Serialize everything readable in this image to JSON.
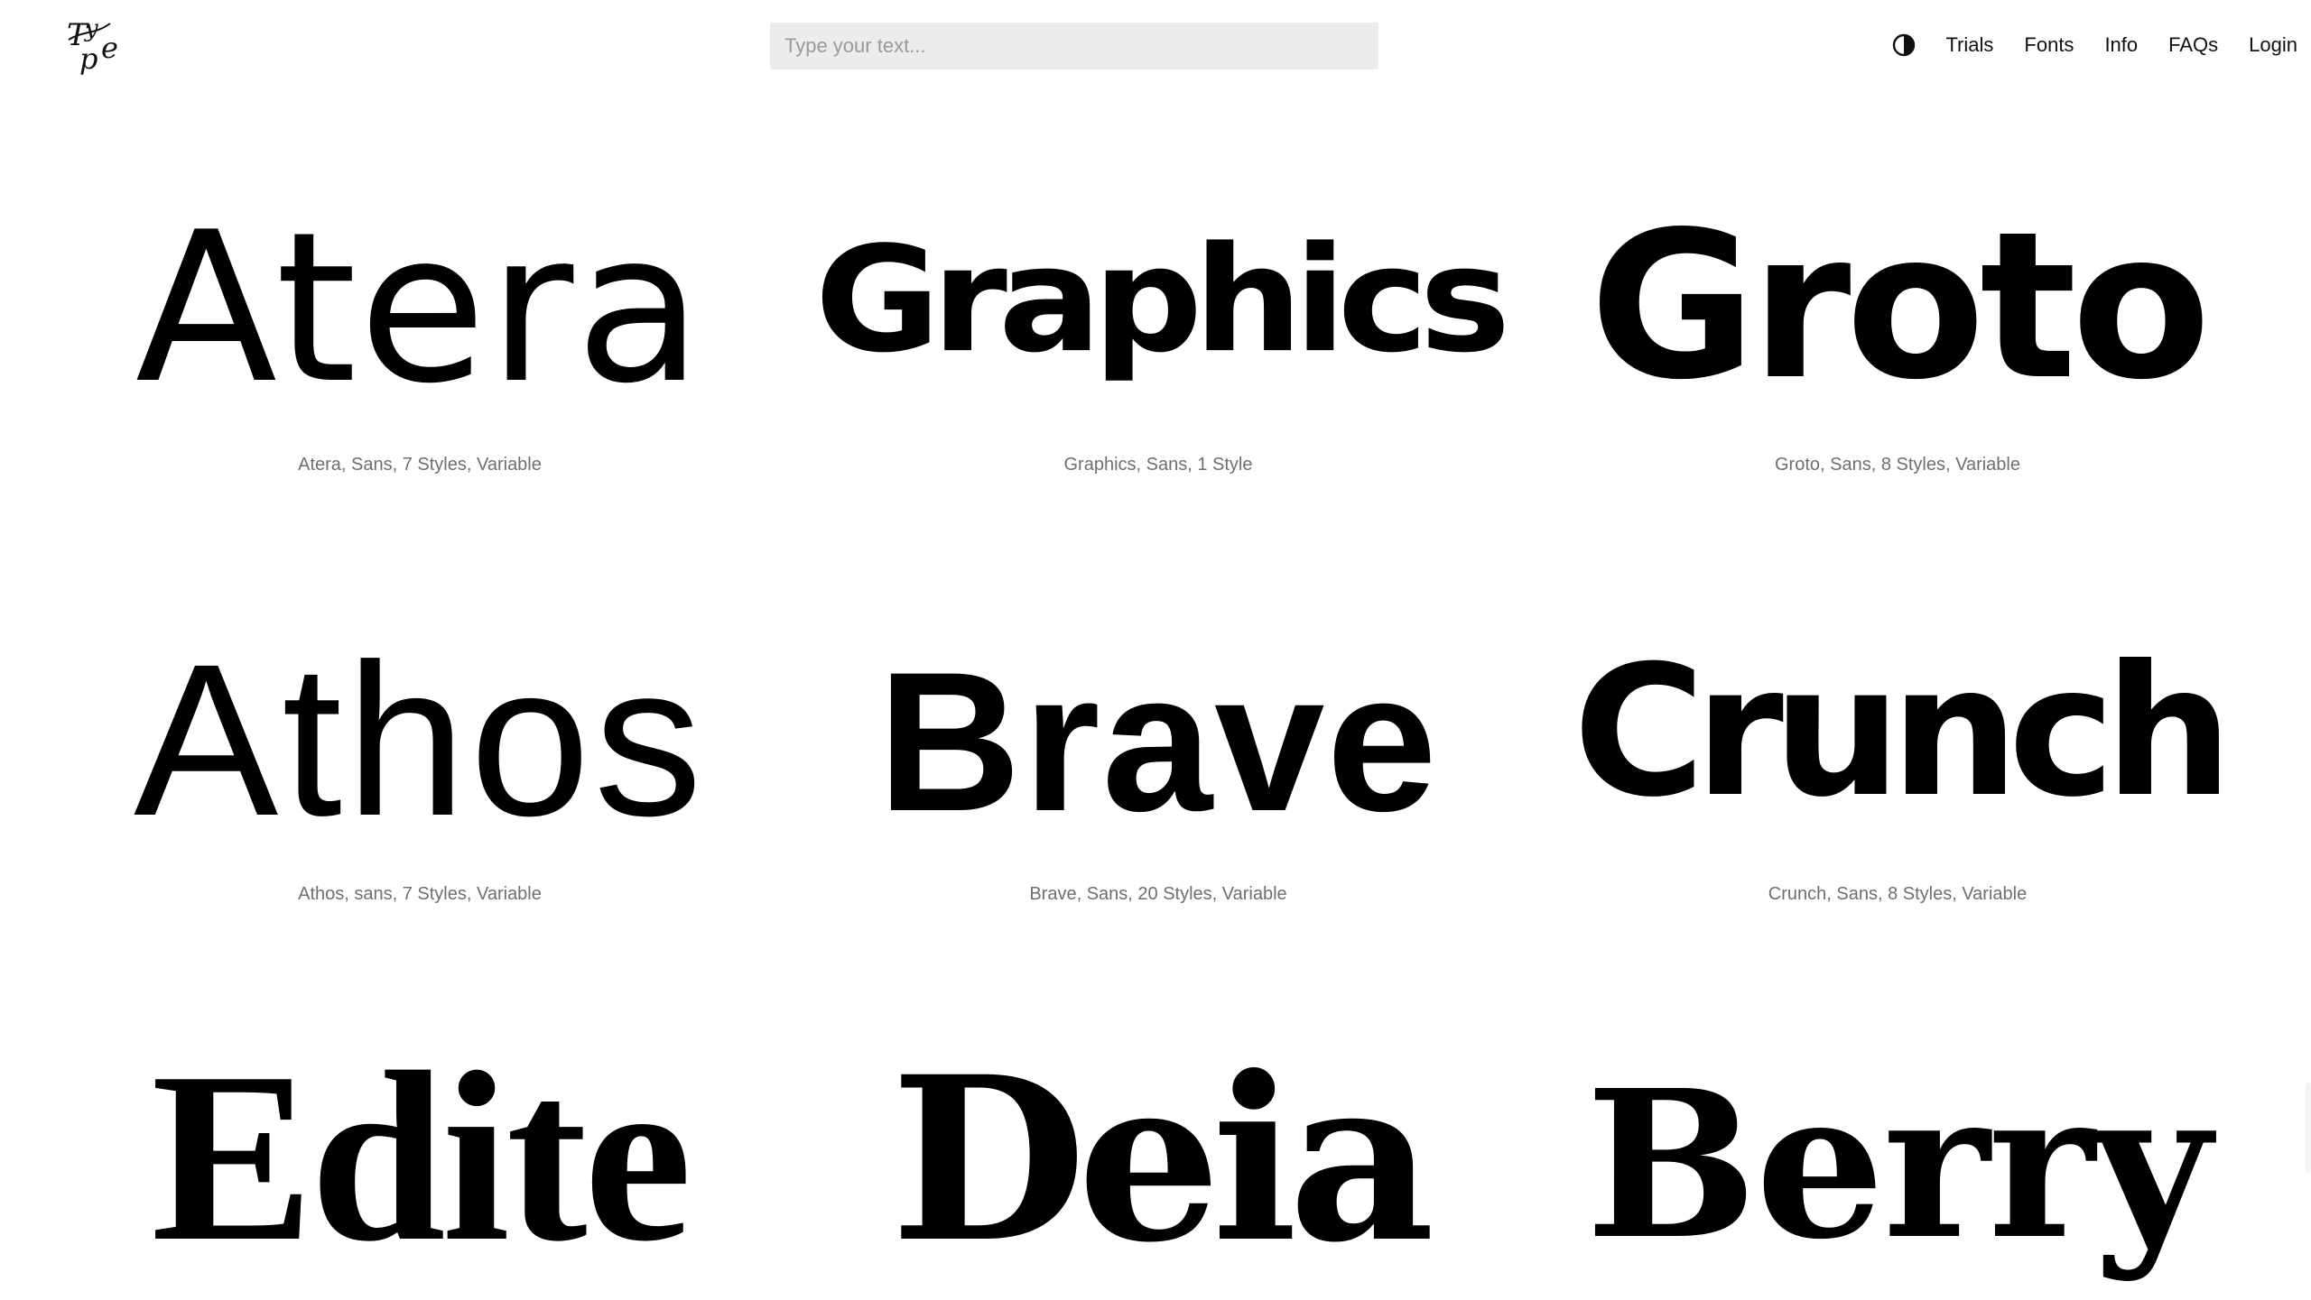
{
  "header": {
    "logo_alt": "Type",
    "search": {
      "placeholder": "Type your text...",
      "value": ""
    },
    "theme_toggle_icon": "contrast-icon",
    "nav": [
      {
        "label": "Trials"
      },
      {
        "label": "Fonts"
      },
      {
        "label": "Info"
      },
      {
        "label": "FAQs"
      },
      {
        "label": "Login"
      }
    ]
  },
  "fonts": [
    {
      "sample": "Atera",
      "meta": "Atera, Sans, 7 Styles, Variable"
    },
    {
      "sample": "Graphics",
      "meta": "Graphics, Sans, 1 Style"
    },
    {
      "sample": "Groto",
      "meta": "Groto, Sans, 8 Styles, Variable"
    },
    {
      "sample": "Athos",
      "meta": "Athos, sans, 7 Styles, Variable"
    },
    {
      "sample": "Brave",
      "meta": "Brave, Sans, 20 Styles, Variable"
    },
    {
      "sample": "Crunch",
      "meta": "Crunch, Sans, 8 Styles, Variable"
    },
    {
      "sample": "Edite",
      "meta": ""
    },
    {
      "sample": "Deia",
      "meta": ""
    },
    {
      "sample": "Berry",
      "meta": ""
    }
  ],
  "colors": {
    "text": "#111111",
    "meta": "#6f6f6f",
    "search_bg": "#ececec",
    "background": "#ffffff"
  }
}
